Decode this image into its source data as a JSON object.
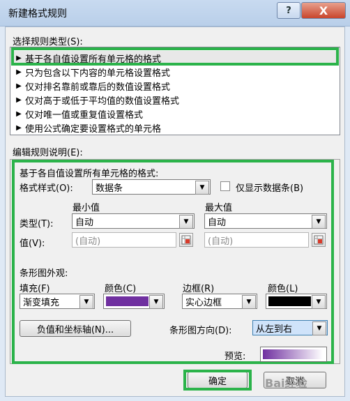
{
  "window": {
    "title": "新建格式规则",
    "help_label": "?",
    "close_label": "X"
  },
  "rule_type": {
    "label": "选择规则类型(S):",
    "items": [
      "基于各自值设置所有单元格的格式",
      "只为包含以下内容的单元格设置格式",
      "仅对排名靠前或靠后的数值设置格式",
      "仅对高于或低于平均值的数值设置格式",
      "仅对唯一值或重复值设置格式",
      "使用公式确定要设置格式的单元格"
    ],
    "selected_index": 0
  },
  "description": {
    "label": "编辑规则说明(E):",
    "heading": "基于各自值设置所有单元格的格式:",
    "format_style_label": "格式样式(O):",
    "format_style_value": "数据条",
    "show_bar_only_label": "仅显示数据条(B)",
    "min_header": "最小值",
    "max_header": "最大值",
    "type_label": "类型(T):",
    "min_type": "自动",
    "max_type": "自动",
    "value_label": "值(V):",
    "min_value": "(自动)",
    "max_value": "(自动)",
    "appearance_label": "条形图外观:",
    "fill_label": "填充(F)",
    "fill_value": "渐变填充",
    "fill_color_label": "颜色(C)",
    "border_label": "边框(R)",
    "border_value": "实心边框",
    "border_color_label": "颜色(L)",
    "axis_button": "负值和坐标轴(N)...",
    "direction_label": "条形图方向(D):",
    "direction_value": "从左到右",
    "preview_label": "预览:"
  },
  "buttons": {
    "ok": "确定",
    "cancel": "取消"
  },
  "watermark": "Bai经验",
  "colors": {
    "fill_color": "#7030a0",
    "border_color": "#000000",
    "highlight": "#2bb34a"
  },
  "icons": {
    "dropdown": "▼",
    "list_arrow": "▶",
    "range_picker": "range-picker-icon"
  }
}
